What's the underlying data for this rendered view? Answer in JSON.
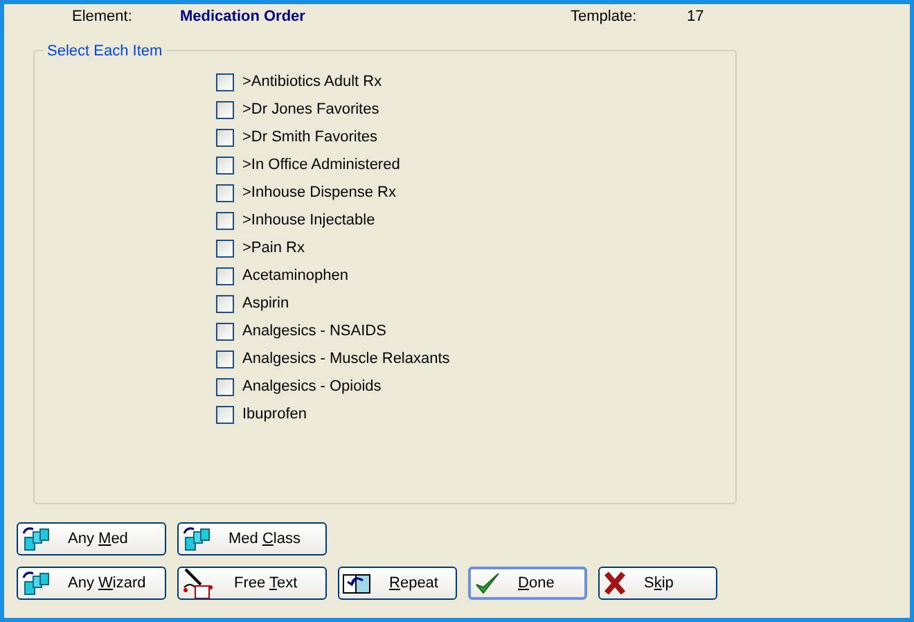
{
  "header": {
    "element_label": "Element:",
    "element_value": "Medication Order",
    "template_label": "Template:",
    "template_value": "17"
  },
  "group": {
    "title": "Select Each Item",
    "items": [
      {
        "label": ">Antibiotics Adult Rx",
        "checked": false
      },
      {
        "label": ">Dr Jones Favorites",
        "checked": false
      },
      {
        "label": ">Dr Smith Favorites",
        "checked": false
      },
      {
        "label": ">In Office Administered",
        "checked": false
      },
      {
        "label": ">Inhouse Dispense Rx",
        "checked": false
      },
      {
        "label": ">Inhouse Injectable",
        "checked": false
      },
      {
        "label": ">Pain Rx",
        "checked": false
      },
      {
        "label": "Acetaminophen",
        "checked": false
      },
      {
        "label": "Aspirin",
        "checked": false
      },
      {
        "label": "Analgesics - NSAIDS",
        "checked": false
      },
      {
        "label": "Analgesics - Muscle Relaxants",
        "checked": false
      },
      {
        "label": "Analgesics - Opioids",
        "checked": false
      },
      {
        "label": "Ibuprofen",
        "checked": false
      }
    ]
  },
  "button_rows": [
    [
      {
        "kind": "wizard",
        "before": "Any ",
        "key": "M",
        "after": "ed",
        "default": false
      },
      {
        "kind": "wizard",
        "before": "Med ",
        "key": "C",
        "after": "lass",
        "default": false
      }
    ],
    [
      {
        "kind": "wizard",
        "before": "Any ",
        "key": "W",
        "after": "izard",
        "default": false
      },
      {
        "kind": "freetext",
        "before": "Free ",
        "key": "T",
        "after": "ext",
        "default": false
      },
      {
        "kind": "repeat",
        "key": "R",
        "after": "epeat",
        "default": false
      },
      {
        "kind": "done",
        "key": "D",
        "after": "one",
        "default": true
      },
      {
        "kind": "skip",
        "before": "S",
        "key": "k",
        "after": "ip",
        "default": false
      }
    ]
  ]
}
